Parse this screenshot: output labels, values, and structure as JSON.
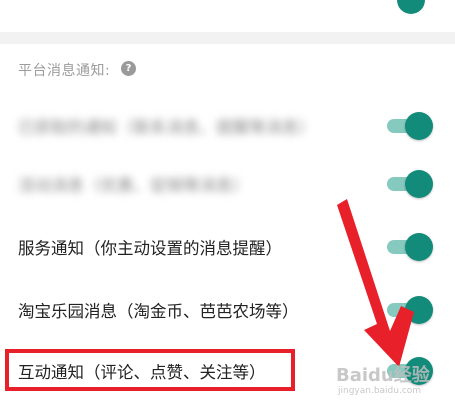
{
  "section": {
    "title": "平台消息通知:",
    "help_glyph": "?"
  },
  "rows": [
    {
      "label": "已获取的通知（联系消息、提醒等消息）",
      "toggle_on": true,
      "blurred": true
    },
    {
      "label": "活动消息（优惠、促销等消息）",
      "toggle_on": true,
      "blurred": true
    },
    {
      "label": "服务通知（你主动设置的消息提醒）",
      "toggle_on": true,
      "blurred": false
    },
    {
      "label": "淘宝乐园消息（淘金币、芭芭农场等）",
      "toggle_on": true,
      "blurred": false
    },
    {
      "label": "互动通知（评论、点赞、关注等）",
      "toggle_on": true,
      "blurred": false
    }
  ],
  "watermark": {
    "text": "Baidu经验",
    "subtext": "jingyan.baidu.com"
  },
  "colors": {
    "toggle_on_thumb": "#128b7a",
    "toggle_on_track": "#86c9bf",
    "annotation_red": "#e8202a"
  }
}
